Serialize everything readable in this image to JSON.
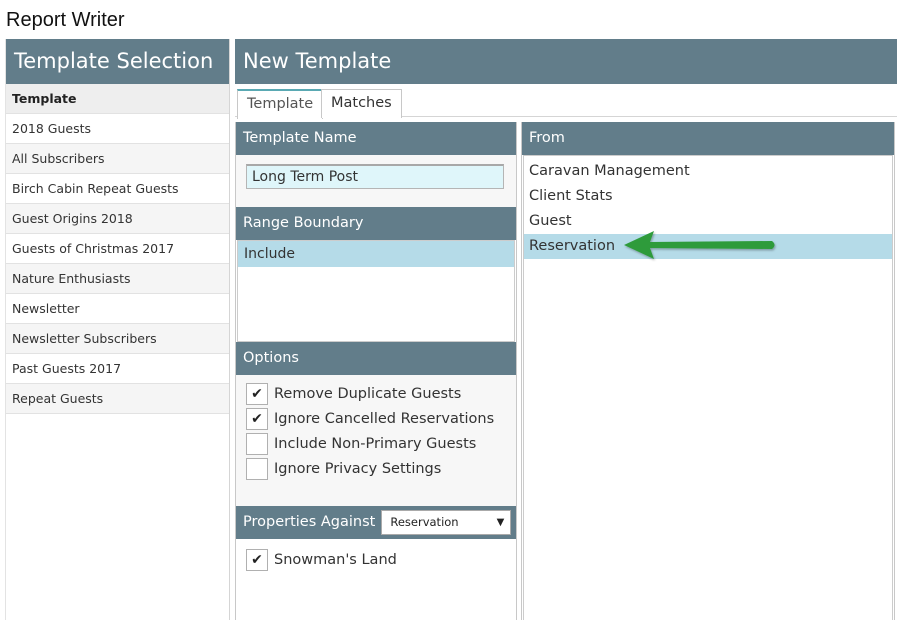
{
  "app": {
    "title": "Report Writer"
  },
  "sidebar": {
    "heading": "Template Selection",
    "column_header": "Template",
    "items": [
      "2018 Guests",
      "All Subscribers",
      "Birch Cabin Repeat Guests",
      "Guest Origins 2018",
      "Guests of Christmas 2017",
      "Nature Enthusiasts",
      "Newsletter",
      "Newsletter Subscribers",
      "Past Guests 2017",
      "Repeat Guests"
    ]
  },
  "main": {
    "heading": "New Template",
    "tabs": [
      {
        "label": "Template",
        "active": true
      },
      {
        "label": "Matches",
        "active": false
      }
    ],
    "template_name": {
      "label": "Template Name",
      "value": "Long Term Post"
    },
    "range_boundary": {
      "label": "Range Boundary",
      "selected": "Include"
    },
    "options": {
      "label": "Options",
      "items": [
        {
          "label": "Remove Duplicate Guests",
          "checked": true
        },
        {
          "label": "Ignore Cancelled Reservations",
          "checked": true
        },
        {
          "label": "Include Non-Primary Guests",
          "checked": false
        },
        {
          "label": "Ignore Privacy Settings",
          "checked": false
        }
      ]
    },
    "properties": {
      "label": "Properties Against",
      "select_value": "Reservation",
      "items": [
        {
          "label": "Snowman's Land",
          "checked": true
        }
      ]
    },
    "from": {
      "label": "From",
      "items": [
        "Caravan Management",
        "Client Stats",
        "Guest",
        "Reservation"
      ],
      "selected_index": 3
    }
  },
  "annotation": {
    "arrow_color": "#2e9b3b"
  },
  "colors": {
    "header_bg": "#627d8a",
    "selection_bg": "#b5dbe8",
    "input_bg": "#dff6fa",
    "tab_accent": "#5aa9b3"
  }
}
